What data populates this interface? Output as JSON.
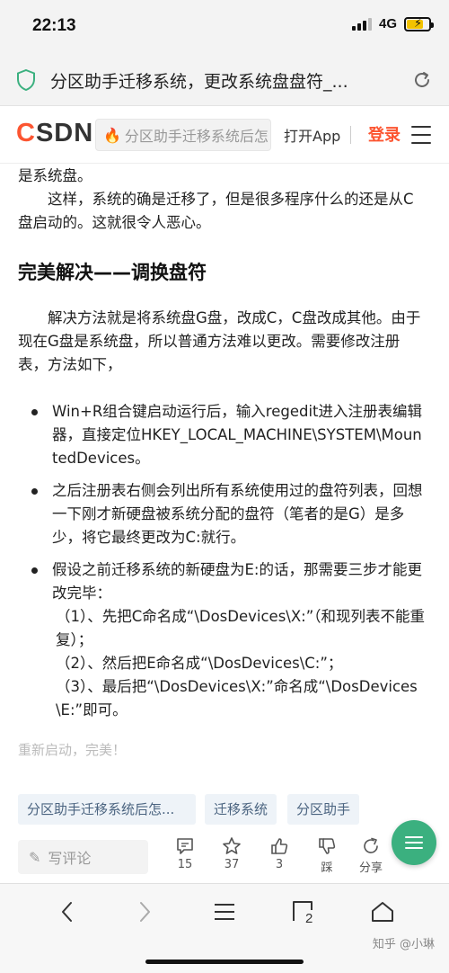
{
  "status": {
    "time": "22:13",
    "network": "4G"
  },
  "browser": {
    "page_title": "分区助手迁移系统，更改系统盘盘符_..."
  },
  "header": {
    "logo": "CSDN",
    "search_placeholder": "分区助手迁移系统后怎",
    "open_app": "打开App",
    "login": "登录"
  },
  "article": {
    "p0": "是系统盘。",
    "p1": "这样，系统的确是迁移了，但是很多程序什么的还是从C盘启动的。这就很令人恶心。",
    "h2": "完美解决——调换盘符",
    "p2": "解决方法就是将系统盘G盘，改成C，C盘改成其他。由于现在G盘是系统盘，所以普通方法难以更改。需要修改注册表，方法如下，",
    "bullets": {
      "b1": "Win+R组合键启动运行后，输入regedit进入注册表编辑器，直接定位HKEY_LOCAL_MACHINE\\SYSTEM\\MountedDevices。",
      "b2": "之后注册表右侧会列出所有系统使用过的盘符列表，回想一下刚才新硬盘被系统分配的盘符（笔者的是G）是多少，将它最终更改为C:就行。",
      "b3": "假设之前迁移系统的新硬盘为E:的话，那需要三步才能更改完毕：",
      "b3_s1": "（1）、先把C命名成“\\DosDevices\\X:”（和现列表不能重复）；",
      "b3_s2": "（2）、然后把E命名成“\\DosDevices\\C:”；",
      "b3_s3": "（3）、最后把“\\DosDevices\\X:”命名成“\\DosDevices\\E:”即可。"
    },
    "faded": "重新启动，完美！"
  },
  "tags": [
    "分区助手迁移系统后怎...",
    "迁移系统",
    "分区助手"
  ],
  "actions": {
    "comment_placeholder": "写评论",
    "comments": "15",
    "favorites": "37",
    "likes": "3",
    "dislike": "踩",
    "share": "分享"
  },
  "nav": {
    "tabs_count": "2"
  },
  "watermark": "知乎 @小琳",
  "colors": {
    "brand": "#fc5531",
    "fab": "#3bb07f",
    "tag_bg": "#eef3f8"
  }
}
